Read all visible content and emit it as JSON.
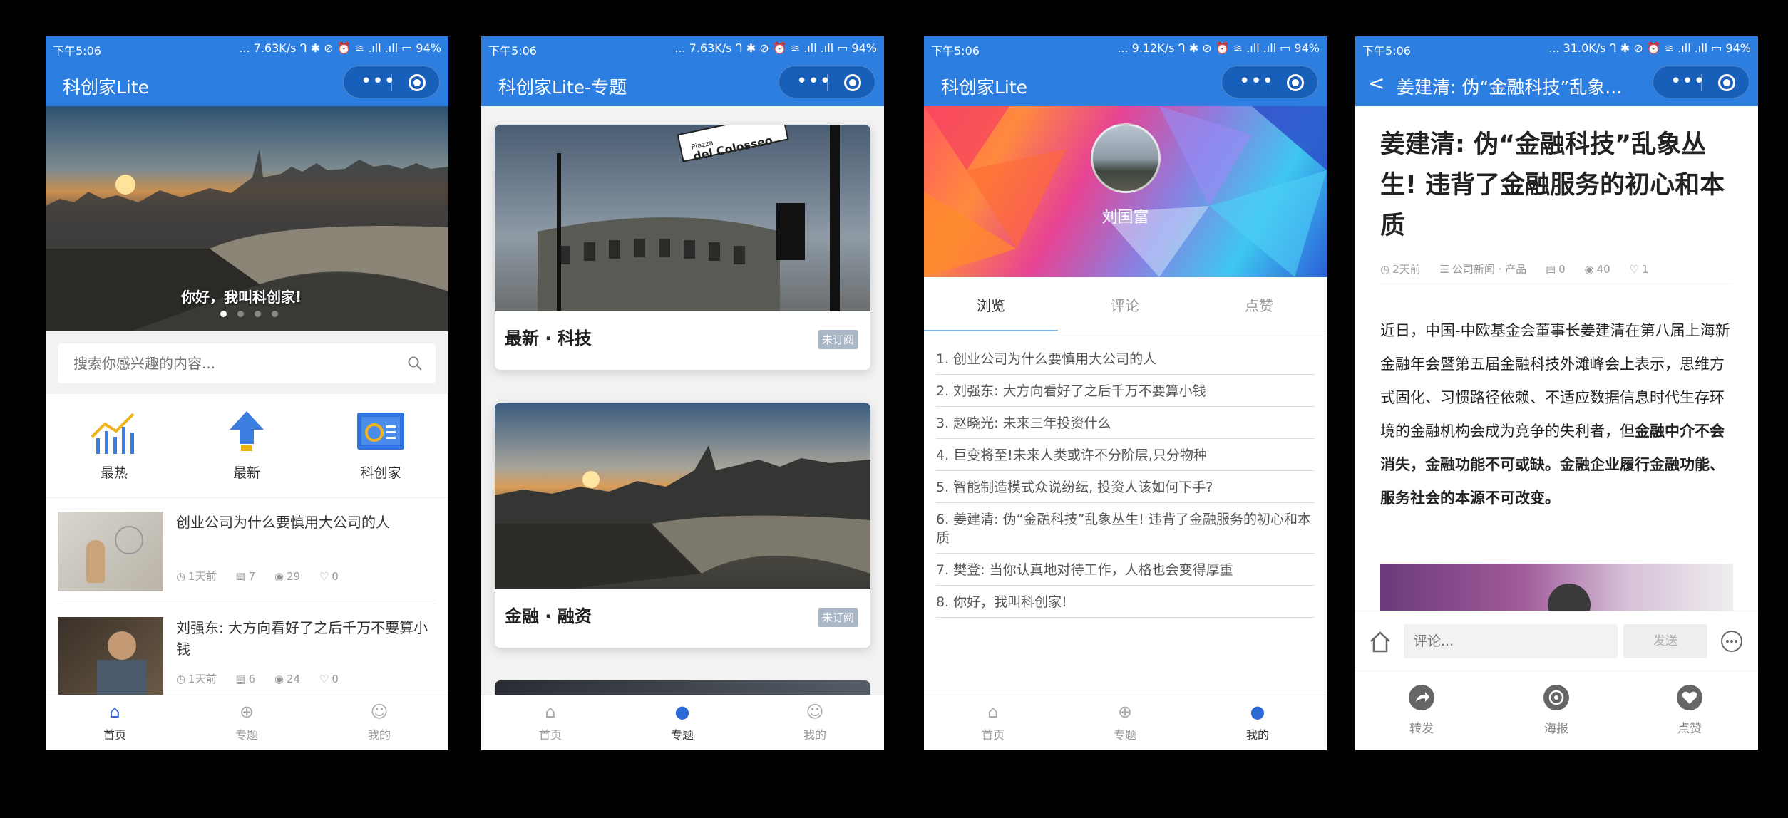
{
  "status": {
    "time": "下午5:06",
    "s1": "... 7.63K/s ᒉ ✱ ⊘ ⏰ ≋ .ıll .ıll ▭ 94%",
    "s2": "... 7.63K/s ᒉ ✱ ⊘ ⏰ ≋ .ıll .ıll ▭ 94%",
    "s3": "... 9.12K/s ᒉ ✱ ⊘ ⏰ ≋ .ıll .ıll ▭ 94%",
    "s4": "... 31.0K/s ᒉ ✱ ⊘ ⏰ ≋ .ıll .ıll ▭ 94%"
  },
  "capsule": {
    "dots": "•••"
  },
  "tabs": {
    "home": "首页",
    "topic": "专题",
    "mine": "我的"
  },
  "screen1": {
    "title": "科创家Lite",
    "banner_text": "你好，我叫科创家!",
    "search_placeholder": "搜索你感兴趣的内容...",
    "cats": [
      {
        "label": "最热"
      },
      {
        "label": "最新"
      },
      {
        "label": "科创家"
      }
    ],
    "articles": [
      {
        "title": "创业公司为什么要慎用大公司的人",
        "time": "1天前",
        "comments": "7",
        "views": "29",
        "likes": "0"
      },
      {
        "title": "刘强东: 大方向看好了之后千万不要算小钱",
        "time": "1天前",
        "comments": "6",
        "views": "24",
        "likes": "0"
      }
    ]
  },
  "screen2": {
    "title": "科创家Lite-专题",
    "cards": [
      {
        "title": "最新 · 科技",
        "badge": "未订阅",
        "sign1": "Piazza",
        "sign2": "del Colosseo"
      },
      {
        "title": "金融 · 融资",
        "badge": "未订阅"
      }
    ]
  },
  "screen3": {
    "title": "科创家Lite",
    "user": "刘国富",
    "tabs": [
      "浏览",
      "评论",
      "点赞"
    ],
    "list": [
      "1. 创业公司为什么要慎用大公司的人",
      "2. 刘强东: 大方向看好了之后千万不要算小钱",
      "3. 赵晓光: 未来三年投资什么",
      "4. 巨变将至!未来人类或许不分阶层,只分物种",
      "5. 智能制造模式众说纷纭, 投资人该如何下手?",
      "6. 姜建清: 伪“金融科技”乱象丛生! 违背了金融服务的初心和本质",
      "7. 樊登: 当你认真地对待工作，人格也会变得厚重",
      "8. 你好，我叫科创家!"
    ]
  },
  "screen4": {
    "title": "姜建清: 伪“金融科技”乱象...",
    "headline": "姜建清: 伪“金融科技”乱象丛生! 违背了金融服务的初心和本质",
    "time": "2天前",
    "category": "公司新闻 · 产品",
    "comments": "0",
    "views": "40",
    "likes": "1",
    "body_plain": "近日，中国-中欧基金会董事长姜建清在第八届上海新金融年会暨第五届金融科技外滩峰会上表示，思维方式固化、习惯路径依赖、不适应数据信息时代生存环境的金融机构会成为竞争的失利者，但",
    "body_bold": "金融中介不会消失，金融功能不可或缺。金融企业履行金融功能、服务社会的本源不可改变。",
    "comment_placeholder": "评论...",
    "send": "发送",
    "actions": [
      "转发",
      "海报",
      "点赞"
    ]
  },
  "colors": {
    "primary": "#2c7ee0",
    "capsule": "#175fb8",
    "active_tab": "#2c6bd6",
    "badge": "#a9b7c6"
  },
  "icons": [
    "home-icon",
    "topic-icon",
    "user-icon",
    "search-icon",
    "clock-icon",
    "comment-icon",
    "eye-icon",
    "heart-icon",
    "share-icon",
    "poster-icon",
    "like-icon",
    "more-icon",
    "back-icon"
  ]
}
